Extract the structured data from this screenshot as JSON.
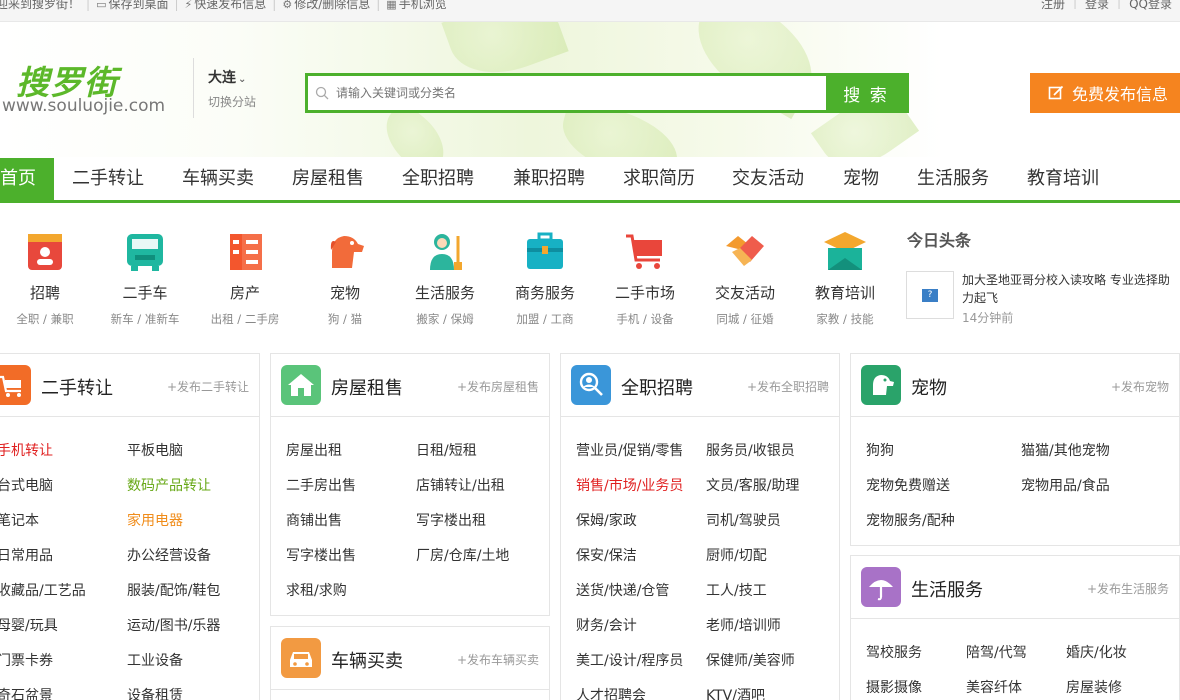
{
  "topbar": {
    "welcome": "迎来到搜罗街！",
    "save_desktop": "保存到桌面",
    "quick_publish": "快速发布信息",
    "edit_delete": "修改/删除信息",
    "mobile_browse": "手机浏览",
    "register": "注册",
    "login": "登录",
    "qq_login": "QQ登录"
  },
  "header": {
    "logo_cn": "搜罗街",
    "logo_en": "www.souluojie.com",
    "city": "大连",
    "city_switch": "切换分站",
    "search_placeholder": "请输入关键词或分类名",
    "search_button": "搜 索",
    "publish_button": "免费发布信息"
  },
  "nav": {
    "items": [
      "首页",
      "二手转让",
      "车辆买卖",
      "房屋租售",
      "全职招聘",
      "兼职招聘",
      "求职简历",
      "交友活动",
      "宠物",
      "生活服务",
      "教育培训"
    ]
  },
  "categories": [
    {
      "name": "招聘",
      "sub": "全职 / 兼职",
      "color": "#e8483c",
      "icon": "id-badge-icon"
    },
    {
      "name": "二手车",
      "sub": "新车 / 准新车",
      "color": "#1fb7a0",
      "icon": "bus-icon"
    },
    {
      "name": "房产",
      "sub": "出租 / 二手房",
      "color": "#f3562d",
      "icon": "building-icon"
    },
    {
      "name": "宠物",
      "sub": "狗 / 猫",
      "color": "#f26b3a",
      "icon": "dog-icon"
    },
    {
      "name": "生活服务",
      "sub": "搬家 / 保姆",
      "color": "#2cb59d",
      "icon": "cleaner-icon"
    },
    {
      "name": "商务服务",
      "sub": "加盟 / 工商",
      "color": "#17b1c4",
      "icon": "briefcase-icon"
    },
    {
      "name": "二手市场",
      "sub": "手机 / 设备",
      "color": "#e9463b",
      "icon": "cart-icon"
    },
    {
      "name": "交友活动",
      "sub": "同城 / 征婚",
      "color": "#f39a2e",
      "icon": "handshake-icon"
    },
    {
      "name": "教育培训",
      "sub": "家教 / 技能",
      "color": "#1bb39a",
      "icon": "graduation-cap-icon"
    }
  ],
  "headlines": {
    "title": "今日头条",
    "news": "加大圣地亚哥分校入读攻略 专业选择助力起飞",
    "time": "14分钟前"
  },
  "panels": {
    "ershou": {
      "title": "二手转让",
      "add": "+发布二手转让",
      "color": "#f26c27",
      "col1": [
        "手机转让",
        "台式电脑",
        "笔记本",
        "日常用品",
        "收藏品/工艺品",
        "母婴/玩具",
        "门票卡券",
        "奇石盆景"
      ],
      "col2": [
        "平板电脑",
        "数码产品转让",
        "家用电器",
        "办公经营设备",
        "服装/配饰/鞋包",
        "运动/图书/乐器",
        "工业设备",
        "设备租赁"
      ]
    },
    "fangwu": {
      "title": "房屋租售",
      "add": "+发布房屋租售",
      "color": "#5ac47a",
      "col1": [
        "房屋出租",
        "二手房出售",
        "商铺出售",
        "写字楼出售",
        "求租/求购"
      ],
      "col2": [
        "日租/短租",
        "店铺转让/出租",
        "写字楼出租",
        "厂房/仓库/土地"
      ]
    },
    "cheliang": {
      "title": "车辆买卖",
      "add": "+发布车辆买卖",
      "color": "#f29a42"
    },
    "quanzhi": {
      "title": "全职招聘",
      "add": "+发布全职招聘",
      "color": "#3a96d9",
      "col1": [
        "营业员/促销/零售",
        "销售/市场/业务员",
        "保姆/家政",
        "保安/保洁",
        "送货/快递/仓管",
        "财务/会计",
        "美工/设计/程序员",
        "人才招聘会"
      ],
      "col2": [
        "服务员/收银员",
        "文员/客服/助理",
        "司机/驾驶员",
        "厨师/切配",
        "工人/技工",
        "老师/培训师",
        "保健师/美容师",
        "KTV/酒吧"
      ]
    },
    "chongwu": {
      "title": "宠物",
      "add": "+发布宠物",
      "color": "#2aa36a",
      "col1": [
        "狗狗",
        "宠物免费赠送",
        "宠物服务/配种"
      ],
      "col2": [
        "猫猫/其他宠物",
        "宠物用品/食品"
      ]
    },
    "shenghuo": {
      "title": "生活服务",
      "add": "+发布生活服务",
      "color": "#a872c7",
      "col1": [
        "驾校服务",
        "摄影摄像"
      ],
      "col2": [
        "陪驾/代驾",
        "美容纤体"
      ],
      "col3": [
        "婚庆/化妆",
        "房屋装修"
      ]
    }
  }
}
